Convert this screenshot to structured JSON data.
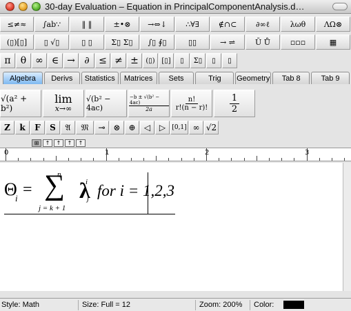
{
  "window": {
    "title": "30-day Evaluation – Equation in PrincipalComponentAnalysis.d…"
  },
  "palette_row1": [
    "≤≠≈",
    "∫ab∵",
    "‖ ‖",
    "±•⊗",
    "→⇔↓",
    "∴∀∃",
    "∉∩⊂",
    "∂∞ℓ",
    "λωθ",
    "ΛΩ⊗"
  ],
  "palette_row2": [
    "(▯)[▯]",
    "▯ √▯",
    "▯ ▯",
    "Σ▯ Σ▯",
    "∫▯ ∮▯",
    "▯▯",
    "→ ⇌",
    "Ū Ů",
    "▫▫▫",
    "▦"
  ],
  "palette_row3": [
    "π",
    "θ",
    "∞",
    "∈",
    "→",
    "∂",
    "≤",
    "≠",
    "±",
    "(▯)",
    "[▯]",
    "▯",
    "Σ▯",
    "▯",
    "▯"
  ],
  "tabs": [
    "Algebra",
    "Derivs",
    "Statistics",
    "Matrices",
    "Sets",
    "Trig",
    "Geometry",
    "Tab 8",
    "Tab 9"
  ],
  "templates": {
    "t1": "√(a² + b²)",
    "t2_top": "lim",
    "t2_bottom": "x→∞",
    "t3": "√(b² − 4ac)",
    "t4_num": "−b ± √(b² − 4ac)",
    "t4_den": "2a",
    "t5_num": "n!",
    "t5_den": "r!(n − r)!",
    "t6_num": "1",
    "t6_den": "2"
  },
  "small_row": [
    "Z",
    "k",
    "F",
    "S",
    "𝔄",
    "𝔐",
    "⊸",
    "⊗",
    "⊕",
    "◁",
    "▷",
    "[0,1]",
    "∞",
    "√2"
  ],
  "ruler_tools": [
    "⊞",
    "↑",
    "↑",
    "↑",
    "↑"
  ],
  "ruler": {
    "labels": [
      "0",
      "1",
      "2",
      "3"
    ]
  },
  "equation": {
    "theta": "Θ",
    "theta_sub": "i",
    "equals": "=",
    "sum": "∑",
    "sum_top": "n",
    "sum_bottom": "j = k + 1",
    "lambda": "λ",
    "lambda_sup": "i",
    "lambda_sub": "j",
    "text": "for i = 1,2,3"
  },
  "status": {
    "style": "Style: Math",
    "size": "Size: Full = 12",
    "zoom": "Zoom: 200%",
    "color_label": "Color:",
    "color_value": "#000000"
  }
}
